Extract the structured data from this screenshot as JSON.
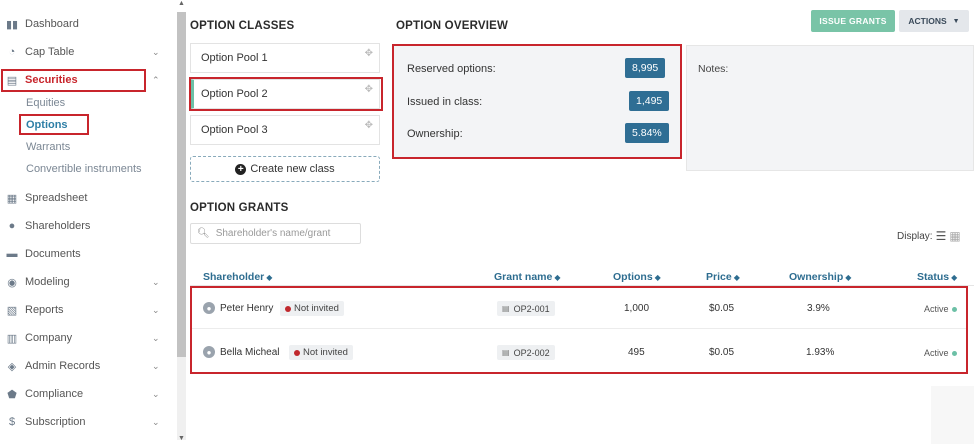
{
  "sidebar": {
    "items": [
      {
        "label": "Dashboard",
        "icon": "dashboard-icon"
      },
      {
        "label": "Cap Table",
        "icon": "pie-chart-icon",
        "chevron": "⌄"
      },
      {
        "label": "Securities",
        "icon": "securities-icon",
        "chevron": "⌃"
      },
      {
        "label": "Spreadsheet",
        "icon": "spreadsheet-icon"
      },
      {
        "label": "Shareholders",
        "icon": "user-icon"
      },
      {
        "label": "Documents",
        "icon": "folder-icon"
      },
      {
        "label": "Modeling",
        "icon": "bulb-icon",
        "chevron": "⌄"
      },
      {
        "label": "Reports",
        "icon": "report-icon",
        "chevron": "⌄"
      },
      {
        "label": "Company",
        "icon": "building-icon",
        "chevron": "⌄"
      },
      {
        "label": "Admin Records",
        "icon": "records-icon",
        "chevron": "⌄"
      },
      {
        "label": "Compliance",
        "icon": "shield-icon",
        "chevron": "⌄"
      },
      {
        "label": "Subscription",
        "icon": "dollar-icon",
        "chevron": "⌄"
      }
    ],
    "securities_sub": [
      "Equities",
      "Options",
      "Warrants",
      "Convertible instruments"
    ]
  },
  "option_classes": {
    "title": "OPTION CLASSES",
    "items": [
      "Option Pool 1",
      "Option Pool 2",
      "Option Pool 3"
    ],
    "create_label": "Create new class"
  },
  "overview": {
    "title": "OPTION OVERVIEW",
    "rows": [
      {
        "label": "Reserved options:",
        "value": "8,995"
      },
      {
        "label": "Issued in class:",
        "value": "1,495"
      },
      {
        "label": "Ownership:",
        "value": "5.84%"
      }
    ],
    "notes_label": "Notes:"
  },
  "header_buttons": {
    "issue": "ISSUE GRANTS",
    "actions": "ACTIONS"
  },
  "grants": {
    "title": "OPTION GRANTS",
    "search_placeholder": "Shareholder's name/grant",
    "display_label": "Display:",
    "columns": [
      "Shareholder",
      "Grant name",
      "Options",
      "Price",
      "Ownership",
      "Status"
    ],
    "rows": [
      {
        "name": "Peter Henry",
        "invite": "Not invited",
        "grant": "OP2-001",
        "options": "1,000",
        "price": "$0.05",
        "ownership": "3.9%",
        "status": "Active"
      },
      {
        "name": "Bella Micheal",
        "invite": "Not invited",
        "grant": "OP2-002",
        "options": "495",
        "price": "$0.05",
        "ownership": "1.93%",
        "status": "Active"
      }
    ]
  },
  "colors": {
    "accent_green": "#79c4a7",
    "badge_blue": "#2f6e94",
    "highlight_red": "#c8252c",
    "header_blue": "#2e6d90"
  }
}
